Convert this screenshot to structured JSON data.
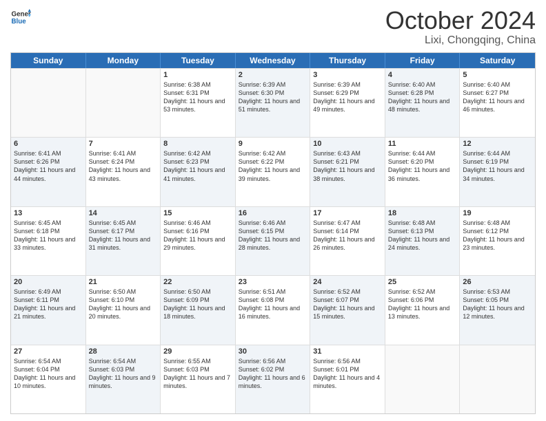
{
  "header": {
    "logo_line1": "General",
    "logo_line2": "Blue",
    "month": "October 2024",
    "location": "Lixi, Chongqing, China"
  },
  "weekdays": [
    "Sunday",
    "Monday",
    "Tuesday",
    "Wednesday",
    "Thursday",
    "Friday",
    "Saturday"
  ],
  "rows": [
    [
      {
        "day": "",
        "text": "",
        "shaded": false,
        "empty": true
      },
      {
        "day": "",
        "text": "",
        "shaded": false,
        "empty": true
      },
      {
        "day": "1",
        "text": "Sunrise: 6:38 AM\nSunset: 6:31 PM\nDaylight: 11 hours and 53 minutes.",
        "shaded": false,
        "empty": false
      },
      {
        "day": "2",
        "text": "Sunrise: 6:39 AM\nSunset: 6:30 PM\nDaylight: 11 hours and 51 minutes.",
        "shaded": true,
        "empty": false
      },
      {
        "day": "3",
        "text": "Sunrise: 6:39 AM\nSunset: 6:29 PM\nDaylight: 11 hours and 49 minutes.",
        "shaded": false,
        "empty": false
      },
      {
        "day": "4",
        "text": "Sunrise: 6:40 AM\nSunset: 6:28 PM\nDaylight: 11 hours and 48 minutes.",
        "shaded": true,
        "empty": false
      },
      {
        "day": "5",
        "text": "Sunrise: 6:40 AM\nSunset: 6:27 PM\nDaylight: 11 hours and 46 minutes.",
        "shaded": false,
        "empty": false
      }
    ],
    [
      {
        "day": "6",
        "text": "Sunrise: 6:41 AM\nSunset: 6:26 PM\nDaylight: 11 hours and 44 minutes.",
        "shaded": true,
        "empty": false
      },
      {
        "day": "7",
        "text": "Sunrise: 6:41 AM\nSunset: 6:24 PM\nDaylight: 11 hours and 43 minutes.",
        "shaded": false,
        "empty": false
      },
      {
        "day": "8",
        "text": "Sunrise: 6:42 AM\nSunset: 6:23 PM\nDaylight: 11 hours and 41 minutes.",
        "shaded": true,
        "empty": false
      },
      {
        "day": "9",
        "text": "Sunrise: 6:42 AM\nSunset: 6:22 PM\nDaylight: 11 hours and 39 minutes.",
        "shaded": false,
        "empty": false
      },
      {
        "day": "10",
        "text": "Sunrise: 6:43 AM\nSunset: 6:21 PM\nDaylight: 11 hours and 38 minutes.",
        "shaded": true,
        "empty": false
      },
      {
        "day": "11",
        "text": "Sunrise: 6:44 AM\nSunset: 6:20 PM\nDaylight: 11 hours and 36 minutes.",
        "shaded": false,
        "empty": false
      },
      {
        "day": "12",
        "text": "Sunrise: 6:44 AM\nSunset: 6:19 PM\nDaylight: 11 hours and 34 minutes.",
        "shaded": true,
        "empty": false
      }
    ],
    [
      {
        "day": "13",
        "text": "Sunrise: 6:45 AM\nSunset: 6:18 PM\nDaylight: 11 hours and 33 minutes.",
        "shaded": false,
        "empty": false
      },
      {
        "day": "14",
        "text": "Sunrise: 6:45 AM\nSunset: 6:17 PM\nDaylight: 11 hours and 31 minutes.",
        "shaded": true,
        "empty": false
      },
      {
        "day": "15",
        "text": "Sunrise: 6:46 AM\nSunset: 6:16 PM\nDaylight: 11 hours and 29 minutes.",
        "shaded": false,
        "empty": false
      },
      {
        "day": "16",
        "text": "Sunrise: 6:46 AM\nSunset: 6:15 PM\nDaylight: 11 hours and 28 minutes.",
        "shaded": true,
        "empty": false
      },
      {
        "day": "17",
        "text": "Sunrise: 6:47 AM\nSunset: 6:14 PM\nDaylight: 11 hours and 26 minutes.",
        "shaded": false,
        "empty": false
      },
      {
        "day": "18",
        "text": "Sunrise: 6:48 AM\nSunset: 6:13 PM\nDaylight: 11 hours and 24 minutes.",
        "shaded": true,
        "empty": false
      },
      {
        "day": "19",
        "text": "Sunrise: 6:48 AM\nSunset: 6:12 PM\nDaylight: 11 hours and 23 minutes.",
        "shaded": false,
        "empty": false
      }
    ],
    [
      {
        "day": "20",
        "text": "Sunrise: 6:49 AM\nSunset: 6:11 PM\nDaylight: 11 hours and 21 minutes.",
        "shaded": true,
        "empty": false
      },
      {
        "day": "21",
        "text": "Sunrise: 6:50 AM\nSunset: 6:10 PM\nDaylight: 11 hours and 20 minutes.",
        "shaded": false,
        "empty": false
      },
      {
        "day": "22",
        "text": "Sunrise: 6:50 AM\nSunset: 6:09 PM\nDaylight: 11 hours and 18 minutes.",
        "shaded": true,
        "empty": false
      },
      {
        "day": "23",
        "text": "Sunrise: 6:51 AM\nSunset: 6:08 PM\nDaylight: 11 hours and 16 minutes.",
        "shaded": false,
        "empty": false
      },
      {
        "day": "24",
        "text": "Sunrise: 6:52 AM\nSunset: 6:07 PM\nDaylight: 11 hours and 15 minutes.",
        "shaded": true,
        "empty": false
      },
      {
        "day": "25",
        "text": "Sunrise: 6:52 AM\nSunset: 6:06 PM\nDaylight: 11 hours and 13 minutes.",
        "shaded": false,
        "empty": false
      },
      {
        "day": "26",
        "text": "Sunrise: 6:53 AM\nSunset: 6:05 PM\nDaylight: 11 hours and 12 minutes.",
        "shaded": true,
        "empty": false
      }
    ],
    [
      {
        "day": "27",
        "text": "Sunrise: 6:54 AM\nSunset: 6:04 PM\nDaylight: 11 hours and 10 minutes.",
        "shaded": false,
        "empty": false
      },
      {
        "day": "28",
        "text": "Sunrise: 6:54 AM\nSunset: 6:03 PM\nDaylight: 11 hours and 9 minutes.",
        "shaded": true,
        "empty": false
      },
      {
        "day": "29",
        "text": "Sunrise: 6:55 AM\nSunset: 6:03 PM\nDaylight: 11 hours and 7 minutes.",
        "shaded": false,
        "empty": false
      },
      {
        "day": "30",
        "text": "Sunrise: 6:56 AM\nSunset: 6:02 PM\nDaylight: 11 hours and 6 minutes.",
        "shaded": true,
        "empty": false
      },
      {
        "day": "31",
        "text": "Sunrise: 6:56 AM\nSunset: 6:01 PM\nDaylight: 11 hours and 4 minutes.",
        "shaded": false,
        "empty": false
      },
      {
        "day": "",
        "text": "",
        "shaded": false,
        "empty": true
      },
      {
        "day": "",
        "text": "",
        "shaded": false,
        "empty": true
      }
    ]
  ]
}
